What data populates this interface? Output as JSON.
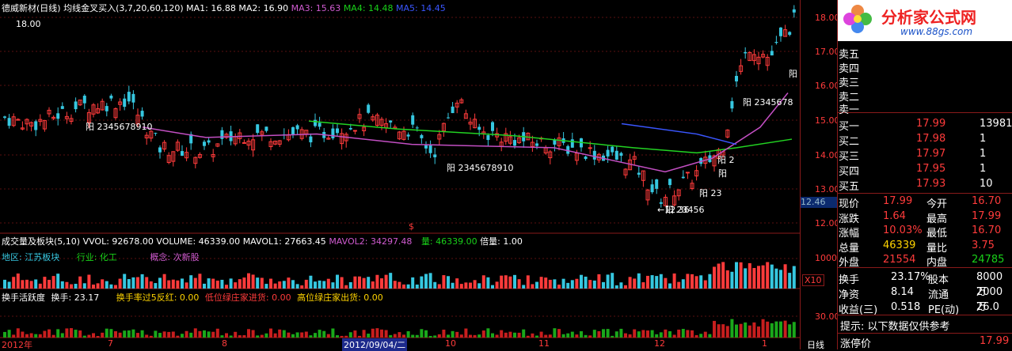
{
  "header": {
    "title": "德威新材(日线)",
    "indicator": "均线金叉买入(3,7,20,60,120)",
    "ma1": "MA1: 16.88",
    "ma2": "MA2: 16.90",
    "ma3": "MA3: 15.63",
    "ma4": "MA4: 14.48",
    "ma5": "MA5: 14.45",
    "top_value": "18.00"
  },
  "price_axis": [
    "18.00",
    "17.00",
    "16.00",
    "15.00",
    "14.00",
    "13.00",
    "12.00"
  ],
  "current_price_tag": "12.46",
  "annotations": {
    "a1": "阳 2345678910",
    "a2": "阳 2345678910",
    "a3": "阳 2345678",
    "a4": "阳 23",
    "a5": "阳 2",
    "a6": "阳",
    "a7": "阳 23456",
    "low_label": "←12.36",
    "dollar": "$"
  },
  "volume_panel": {
    "header": "成交量及板块(5,10)",
    "vvol": "VVOL: 92678.00",
    "volume": "VOLUME: 46339.00",
    "mavol1": "MAVOL1: 27663.45",
    "mavol2": "MAVOL2: 34297.48",
    "liang": "量: 46339.00",
    "beiliang": "倍量: 1.00",
    "region": "地区: 江苏板块",
    "industry": "行业: 化工",
    "concept": "概念: 次新股",
    "axis_10000": "10000",
    "axis_x10": "X10"
  },
  "turnover_panel": {
    "header": "换手活跃度",
    "huanshou": "换手: 23.17",
    "rate": "换手率过5反红: 0.00",
    "low": "低位绿庄家进货: 0.00",
    "high": "高位绿庄家出货: 0.00",
    "axis_30": "30.00"
  },
  "time_axis": [
    "2012年",
    "7",
    "8",
    "2012/09/04/二",
    "10",
    "11",
    "12",
    "1"
  ],
  "period_label": "日线",
  "logo": {
    "title": "分析家公式网",
    "url": "www.88gs.com"
  },
  "orderbook": {
    "sells": [
      {
        "label": "卖五",
        "price": "",
        "vol": ""
      },
      {
        "label": "卖四",
        "price": "",
        "vol": ""
      },
      {
        "label": "卖三",
        "price": "",
        "vol": ""
      },
      {
        "label": "卖二",
        "price": "",
        "vol": ""
      },
      {
        "label": "卖一",
        "price": "",
        "vol": ""
      }
    ],
    "sell_header": "委",
    "buys": [
      {
        "label": "买一",
        "price": "17.99",
        "vol": "13981"
      },
      {
        "label": "买二",
        "price": "17.98",
        "vol": "1"
      },
      {
        "label": "买三",
        "price": "17.97",
        "vol": "1"
      },
      {
        "label": "买四",
        "price": "17.95",
        "vol": "1"
      },
      {
        "label": "买五",
        "price": "17.93",
        "vol": "10"
      }
    ]
  },
  "quote": [
    {
      "l1": "现价",
      "v1": "17.99",
      "l2": "今开",
      "v2": "16.70"
    },
    {
      "l1": "涨跌",
      "v1": "1.64",
      "l2": "最高",
      "v2": "17.99"
    },
    {
      "l1": "涨幅",
      "v1": "10.03%",
      "l2": "最低",
      "v2": "16.70"
    },
    {
      "l1": "总量",
      "v1": "46339",
      "l2": "量比",
      "v2": "3.75"
    },
    {
      "l1": "外盘",
      "v1": "21554",
      "l2": "内盘",
      "v2": "24785"
    }
  ],
  "stats": [
    {
      "l1": "换手",
      "v1": "23.17%",
      "l2": "股本",
      "v2": "8000万"
    },
    {
      "l1": "净资",
      "v1": "8.14",
      "l2": "流通",
      "v2": "2000万"
    },
    {
      "l1": "收益(三)",
      "v1": "0.518",
      "l2": "PE(动)",
      "v2": "26.0"
    }
  ],
  "notice": "提示:  以下数据仅供参考",
  "limit_up": {
    "label": "涨停价",
    "value": "17.99"
  },
  "colors": {
    "up": "#ff3b3b",
    "down": "#36c7e0",
    "grid": "#8a1a1a",
    "ma_green": "#22d322",
    "ma_magenta": "#c34fc3"
  }
}
